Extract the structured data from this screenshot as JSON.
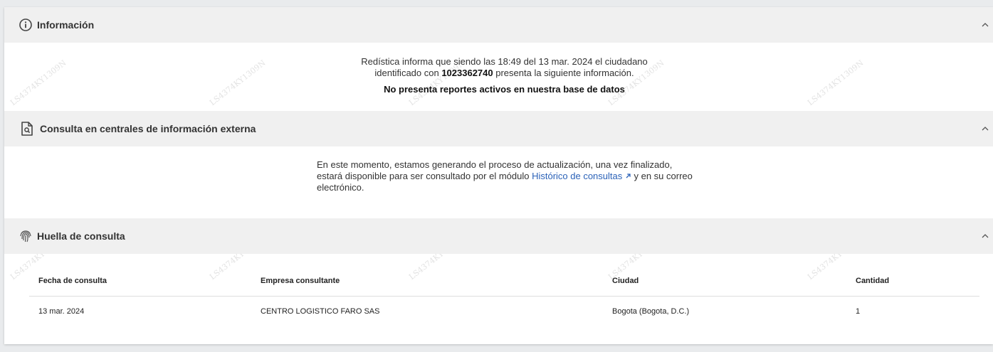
{
  "info": {
    "title": "Información",
    "line1": "Redística informa que siendo las 18:49 del 13 mar. 2024 el ciudadano",
    "line2_pre": "identificado con ",
    "id_number": "1023362740",
    "line2_post": " presenta la siguiente información.",
    "status": "No presenta reportes activos en nuestra base de datos"
  },
  "external": {
    "title": "Consulta en centrales de información externa",
    "line1": "En este momento, estamos generando el proceso de actualización, una vez finalizado,",
    "line2_pre": "estará disponible para ser consultado por el módulo ",
    "link": "Histórico de consultas",
    "line2_post": " y en su correo",
    "line3": "electrónico."
  },
  "huella": {
    "title": "Huella de consulta",
    "columns": [
      "Fecha de consulta",
      "Empresa consultante",
      "Ciudad",
      "Cantidad"
    ],
    "rows": [
      [
        "13 mar. 2024",
        "CENTRO LOGISTICO FARO SAS",
        "Bogota (Bogota, D.C.)",
        "1"
      ]
    ]
  },
  "watermark": "LS4374KY1309N",
  "icons": {
    "info": "info-circle-icon",
    "external": "document-search-icon",
    "huella": "fingerprint-icon",
    "collapse": "chevron-up-icon"
  }
}
